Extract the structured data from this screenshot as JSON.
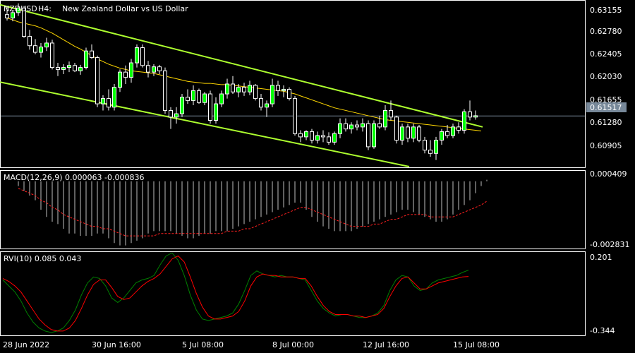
{
  "colors": {
    "background": "#000000",
    "frame": "#ffffff",
    "bull_body": "#00ff00",
    "bear_body": "#000000",
    "ma": "#ffd700",
    "channel": "#adff2f",
    "macd_hist": "#c0c0c0",
    "macd_signal": "#ff2020",
    "rvi_main": "#008000",
    "rvi_signal": "#ff0000",
    "current_price_line": "#778899"
  },
  "header": {
    "symbol": "NZDUSD",
    "timeframe": "H4:",
    "description": "New Zealand Dollar vs US Dollar"
  },
  "chart_data": [
    {
      "type": "candlestick",
      "title": "NZDUSD, H4:  New Zealand Dollar vs US Dollar",
      "ylim": [
        0.6075,
        0.6325
      ],
      "yticks": [
        "0.63155",
        "0.62780",
        "0.62405",
        "0.62030",
        "0.61655",
        "0.61280",
        "0.60905"
      ],
      "current_price": "0.61517",
      "xticks": [
        "28 Jun 2022",
        "30 Jun 16:00",
        "5 Jul 08:00",
        "8 Jul 00:00",
        "12 Jul 16:00",
        "15 Jul 08:00"
      ],
      "candles_ohlc": [
        [
          0.6305,
          0.6318,
          0.6296,
          0.63
        ],
        [
          0.63,
          0.6312,
          0.6295,
          0.6308
        ],
        [
          0.6308,
          0.6322,
          0.6303,
          0.6315
        ],
        [
          0.6315,
          0.6318,
          0.627,
          0.6272
        ],
        [
          0.6272,
          0.6282,
          0.6252,
          0.6258
        ],
        [
          0.6258,
          0.6268,
          0.6245,
          0.6248
        ],
        [
          0.6248,
          0.6262,
          0.624,
          0.6256
        ],
        [
          0.6256,
          0.627,
          0.625,
          0.6262
        ],
        [
          0.6262,
          0.6267,
          0.6222,
          0.6225
        ],
        [
          0.6225,
          0.6232,
          0.6212,
          0.6222
        ],
        [
          0.6222,
          0.623,
          0.6215,
          0.6225
        ],
        [
          0.6225,
          0.6234,
          0.6218,
          0.6228
        ],
        [
          0.6228,
          0.6232,
          0.6218,
          0.622
        ],
        [
          0.622,
          0.6229,
          0.6214,
          0.6225
        ],
        [
          0.6225,
          0.6255,
          0.6222,
          0.625
        ],
        [
          0.625,
          0.626,
          0.6238,
          0.624
        ],
        [
          0.624,
          0.6243,
          0.6165,
          0.617
        ],
        [
          0.617,
          0.6183,
          0.616,
          0.6178
        ],
        [
          0.6178,
          0.6192,
          0.616,
          0.6165
        ],
        [
          0.6165,
          0.62,
          0.616,
          0.6195
        ],
        [
          0.6195,
          0.6222,
          0.6188,
          0.6218
        ],
        [
          0.6218,
          0.6228,
          0.62,
          0.621
        ],
        [
          0.621,
          0.6238,
          0.6202,
          0.6232
        ],
        [
          0.6232,
          0.626,
          0.6225,
          0.6255
        ],
        [
          0.6255,
          0.626,
          0.6225,
          0.6228
        ],
        [
          0.6228,
          0.6235,
          0.621,
          0.6218
        ],
        [
          0.6218,
          0.623,
          0.6212,
          0.6226
        ],
        [
          0.6226,
          0.6229,
          0.6215,
          0.622
        ],
        [
          0.622,
          0.6225,
          0.6155,
          0.616
        ],
        [
          0.616,
          0.6165,
          0.6132,
          0.615
        ],
        [
          0.615,
          0.6165,
          0.614,
          0.6155
        ],
        [
          0.6155,
          0.6185,
          0.615,
          0.618
        ],
        [
          0.618,
          0.6192,
          0.617,
          0.6175
        ],
        [
          0.6175,
          0.6198,
          0.6168,
          0.619
        ],
        [
          0.619,
          0.6193,
          0.617,
          0.6172
        ],
        [
          0.6172,
          0.6188,
          0.6168,
          0.6185
        ],
        [
          0.6185,
          0.619,
          0.614,
          0.6145
        ],
        [
          0.6145,
          0.618,
          0.614,
          0.617
        ],
        [
          0.617,
          0.619,
          0.6165,
          0.6185
        ],
        [
          0.6185,
          0.6208,
          0.6178,
          0.62
        ],
        [
          0.62,
          0.6212,
          0.6185,
          0.6188
        ],
        [
          0.6188,
          0.62,
          0.618,
          0.6195
        ],
        [
          0.6195,
          0.6202,
          0.6182,
          0.6188
        ],
        [
          0.6188,
          0.6205,
          0.6183,
          0.6198
        ],
        [
          0.6198,
          0.62,
          0.6175,
          0.6178
        ],
        [
          0.6178,
          0.6185,
          0.616,
          0.6165
        ],
        [
          0.6165,
          0.6175,
          0.615,
          0.617
        ],
        [
          0.617,
          0.6208,
          0.6165,
          0.6198
        ],
        [
          0.6198,
          0.6205,
          0.6182,
          0.619
        ],
        [
          0.619,
          0.6198,
          0.618,
          0.6192
        ],
        [
          0.6192,
          0.6195,
          0.6175,
          0.6178
        ],
        [
          0.6178,
          0.6182,
          0.6122,
          0.6125
        ],
        [
          0.6125,
          0.613,
          0.6112,
          0.612
        ],
        [
          0.612,
          0.613,
          0.6115,
          0.6128
        ],
        [
          0.6128,
          0.6132,
          0.611,
          0.6115
        ],
        [
          0.6115,
          0.6128,
          0.611,
          0.6122
        ],
        [
          0.6122,
          0.613,
          0.6112,
          0.612
        ],
        [
          0.612,
          0.6127,
          0.6108,
          0.6112
        ],
        [
          0.6112,
          0.6128,
          0.6108,
          0.6125
        ],
        [
          0.6125,
          0.6148,
          0.6118,
          0.614
        ],
        [
          0.614,
          0.6148,
          0.6128,
          0.6132
        ],
        [
          0.6132,
          0.6142,
          0.6125,
          0.6138
        ],
        [
          0.6138,
          0.6145,
          0.613,
          0.6135
        ],
        [
          0.6135,
          0.6148,
          0.6128,
          0.614
        ],
        [
          0.614,
          0.6145,
          0.61,
          0.6105
        ],
        [
          0.6105,
          0.6145,
          0.6102,
          0.614
        ],
        [
          0.614,
          0.6152,
          0.6132,
          0.6135
        ],
        [
          0.6135,
          0.6168,
          0.613,
          0.616
        ],
        [
          0.616,
          0.6175,
          0.6145,
          0.615
        ],
        [
          0.615,
          0.6152,
          0.611,
          0.6115
        ],
        [
          0.6115,
          0.614,
          0.6108,
          0.6135
        ],
        [
          0.6135,
          0.614,
          0.6112,
          0.6118
        ],
        [
          0.6118,
          0.614,
          0.6112,
          0.6135
        ],
        [
          0.6135,
          0.6138,
          0.6112,
          0.6115
        ],
        [
          0.6115,
          0.612,
          0.6095,
          0.61
        ],
        [
          0.61,
          0.6115,
          0.609,
          0.6095
        ],
        [
          0.6095,
          0.612,
          0.6085,
          0.6115
        ],
        [
          0.6115,
          0.6132,
          0.6108,
          0.6128
        ],
        [
          0.6128,
          0.6138,
          0.6118,
          0.6122
        ],
        [
          0.6122,
          0.614,
          0.6118,
          0.6135
        ],
        [
          0.6135,
          0.6142,
          0.6125,
          0.613
        ],
        [
          0.613,
          0.6162,
          0.6125,
          0.6158
        ],
        [
          0.6158,
          0.6175,
          0.6145,
          0.615
        ],
        [
          0.615,
          0.616,
          0.6146,
          0.6152
        ]
      ],
      "moving_average": [
        0.63,
        0.6297,
        0.6294,
        0.6292,
        0.629,
        0.6288,
        0.6285,
        0.6281,
        0.6277,
        0.6272,
        0.6267,
        0.6262,
        0.6257,
        0.6253,
        0.6248,
        0.6243,
        0.6238,
        0.6234,
        0.623,
        0.6227,
        0.6224,
        0.6222,
        0.622,
        0.6219,
        0.6218,
        0.6217,
        0.6216,
        0.6214,
        0.6212,
        0.621,
        0.6208,
        0.6206,
        0.6204,
        0.6203,
        0.6202,
        0.6201,
        0.6201,
        0.62,
        0.6199,
        0.6199,
        0.6198,
        0.6197,
        0.6196,
        0.6195,
        0.6194,
        0.6193,
        0.6192,
        0.6191,
        0.619,
        0.6189,
        0.6187,
        0.6185,
        0.6182,
        0.6179,
        0.6176,
        0.6173,
        0.617,
        0.6167,
        0.6164,
        0.6162,
        0.616,
        0.6158,
        0.6156,
        0.6154,
        0.6152,
        0.615,
        0.6148,
        0.6146,
        0.6145,
        0.6144,
        0.6143,
        0.6142,
        0.6141,
        0.614,
        0.6139,
        0.6138,
        0.6137,
        0.6136,
        0.6135,
        0.6134,
        0.6133,
        0.6132,
        0.6131,
        0.613,
        0.6129
      ],
      "channel_upper": [
        [
          0,
          0.632
        ],
        [
          83,
          0.6135
        ]
      ],
      "channel_lower": [
        [
          0,
          0.6203
        ],
        [
          70,
          0.6075
        ]
      ]
    },
    {
      "type": "bar",
      "title": "MACD(12,26,9) 0.000063 -0.000836",
      "ylim": [
        -0.002831,
        0.000409
      ],
      "yticks": [
        "0.000409",
        "-0.002831"
      ],
      "macd": [
        -0.0002,
        -0.0004,
        -0.0006,
        -0.0008,
        -0.0012,
        -0.0015,
        -0.0017,
        -0.0018,
        -0.002,
        -0.0022,
        -0.0022,
        -0.0023,
        -0.0023,
        -0.0023,
        -0.0022,
        -0.0022,
        -0.0024,
        -0.0026,
        -0.0027,
        -0.0027,
        -0.0026,
        -0.0025,
        -0.0024,
        -0.0022,
        -0.0021,
        -0.0021,
        -0.0021,
        -0.0021,
        -0.0022,
        -0.0023,
        -0.0024,
        -0.0024,
        -0.0023,
        -0.0022,
        -0.0022,
        -0.0021,
        -0.0021,
        -0.0021,
        -0.002,
        -0.0019,
        -0.0018,
        -0.0017,
        -0.0016,
        -0.0015,
        -0.0014,
        -0.0013,
        -0.0012,
        -0.0011,
        -0.001,
        -0.0009,
        -0.0009,
        -0.0012,
        -0.0015,
        -0.0017,
        -0.0019,
        -0.002,
        -0.0021,
        -0.0021,
        -0.0021,
        -0.0021,
        -0.002,
        -0.0019,
        -0.0018,
        -0.0017,
        -0.0016,
        -0.0015,
        -0.0014,
        -0.0013,
        -0.0012,
        -0.0012,
        -0.0013,
        -0.0014,
        -0.0015,
        -0.0016,
        -0.0017,
        -0.0017,
        -0.0016,
        -0.0014,
        -0.0012,
        -0.001,
        -0.0008,
        -0.0005,
        -0.0002,
        6.3e-05
      ],
      "signal": [
        -0.0003,
        -0.0004,
        -0.0005,
        -0.0006,
        -0.0008,
        -0.0009,
        -0.0011,
        -0.0012,
        -0.0014,
        -0.0015,
        -0.0016,
        -0.0017,
        -0.0018,
        -0.0019,
        -0.0019,
        -0.002,
        -0.002,
        -0.0021,
        -0.0022,
        -0.0023,
        -0.0023,
        -0.0023,
        -0.0023,
        -0.0023,
        -0.0023,
        -0.0022,
        -0.0022,
        -0.0022,
        -0.0022,
        -0.0022,
        -0.0022,
        -0.0022,
        -0.0022,
        -0.0022,
        -0.0022,
        -0.0022,
        -0.0022,
        -0.0021,
        -0.0021,
        -0.0021,
        -0.002,
        -0.002,
        -0.0019,
        -0.0018,
        -0.0017,
        -0.0016,
        -0.0015,
        -0.0014,
        -0.0013,
        -0.0012,
        -0.0011,
        -0.0011,
        -0.0012,
        -0.0013,
        -0.0014,
        -0.0015,
        -0.0016,
        -0.0017,
        -0.0018,
        -0.0019,
        -0.0019,
        -0.0019,
        -0.0019,
        -0.0018,
        -0.0018,
        -0.0017,
        -0.0016,
        -0.0016,
        -0.0015,
        -0.0014,
        -0.0014,
        -0.0014,
        -0.0014,
        -0.0015,
        -0.0015,
        -0.0015,
        -0.0015,
        -0.0015,
        -0.0014,
        -0.0013,
        -0.0012,
        -0.0011,
        -0.001,
        -0.000836
      ]
    },
    {
      "type": "line",
      "title": "RVI(10) 0.085 0.043",
      "ylim": [
        -0.344,
        0.201
      ],
      "yticks": [
        "0.201",
        "-0.344"
      ],
      "rvi": [
        0.02,
        -0.02,
        -0.06,
        -0.12,
        -0.2,
        -0.26,
        -0.3,
        -0.32,
        -0.33,
        -0.32,
        -0.3,
        -0.25,
        -0.18,
        -0.08,
        0.0,
        0.04,
        0.03,
        -0.02,
        -0.1,
        -0.13,
        -0.1,
        -0.05,
        0.0,
        0.02,
        0.03,
        0.05,
        0.12,
        0.18,
        0.2,
        0.15,
        0.05,
        -0.08,
        -0.18,
        -0.24,
        -0.25,
        -0.24,
        -0.23,
        -0.22,
        -0.2,
        -0.14,
        -0.05,
        0.05,
        0.08,
        0.06,
        0.05,
        0.04,
        0.05,
        0.04,
        0.04,
        0.03,
        0.02,
        -0.05,
        -0.12,
        -0.17,
        -0.2,
        -0.22,
        -0.21,
        -0.21,
        -0.22,
        -0.23,
        -0.23,
        -0.22,
        -0.2,
        -0.15,
        -0.05,
        0.02,
        0.05,
        0.04,
        -0.02,
        -0.05,
        -0.04,
        0.0,
        0.02,
        0.03,
        0.04,
        0.05,
        0.07,
        0.085
      ],
      "rvi_signal": [
        0.03,
        0.01,
        -0.02,
        -0.06,
        -0.12,
        -0.18,
        -0.24,
        -0.28,
        -0.31,
        -0.32,
        -0.32,
        -0.3,
        -0.25,
        -0.17,
        -0.08,
        -0.01,
        0.02,
        0.02,
        -0.03,
        -0.09,
        -0.11,
        -0.1,
        -0.06,
        -0.02,
        0.01,
        0.03,
        0.06,
        0.11,
        0.16,
        0.18,
        0.14,
        0.04,
        -0.07,
        -0.16,
        -0.22,
        -0.24,
        -0.24,
        -0.23,
        -0.22,
        -0.19,
        -0.12,
        -0.02,
        0.04,
        0.06,
        0.05,
        0.05,
        0.04,
        0.04,
        0.04,
        0.03,
        0.03,
        -0.02,
        -0.09,
        -0.15,
        -0.19,
        -0.21,
        -0.21,
        -0.21,
        -0.22,
        -0.22,
        -0.23,
        -0.22,
        -0.21,
        -0.17,
        -0.09,
        -0.02,
        0.03,
        0.04,
        0.0,
        -0.04,
        -0.04,
        -0.02,
        0.0,
        0.01,
        0.02,
        0.03,
        0.04,
        0.043
      ]
    }
  ]
}
